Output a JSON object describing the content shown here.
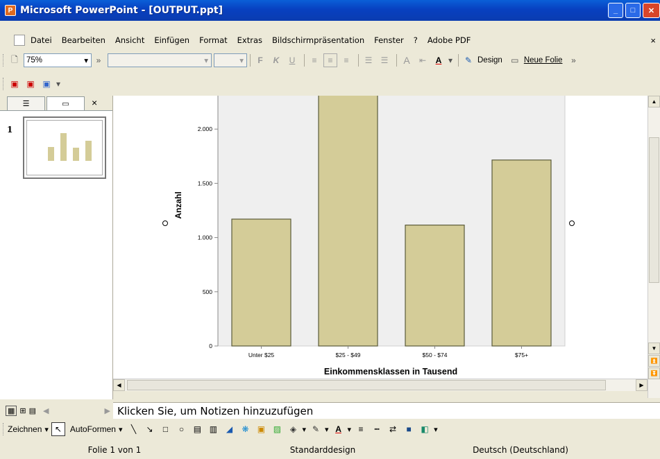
{
  "window": {
    "title": "Microsoft PowerPoint - [OUTPUT.ppt]"
  },
  "menu": [
    "Datei",
    "Bearbeiten",
    "Ansicht",
    "Einfügen",
    "Format",
    "Extras",
    "Bildschirmpräsentation",
    "Fenster",
    "?",
    "Adobe PDF"
  ],
  "menu_close": "×",
  "toolbar": {
    "zoom": "75%",
    "bold": "F",
    "italic": "K",
    "underline": "U",
    "design_label": "Design",
    "new_slide_label": "Neue Folie"
  },
  "panel": {
    "slide_number": "1",
    "close": "×"
  },
  "notes": {
    "placeholder": "Klicken Sie, um Notizen hinzuzufügen"
  },
  "drawing": {
    "draw_label": "Zeichnen",
    "autoshapes_label": "AutoFormen"
  },
  "status": {
    "slide": "Folie 1 von 1",
    "design": "Standarddesign",
    "language": "Deutsch (Deutschland)"
  },
  "colors": {
    "bar": "#d4cc98",
    "bar_stroke": "#5a5a3a",
    "plot_bg": "#efefef"
  },
  "chart_data": {
    "type": "bar",
    "categories": [
      "Unter $25",
      "$25 - $49",
      "$50 - $74",
      "$75+"
    ],
    "values": [
      1170,
      2390,
      1115,
      1715
    ],
    "ylabel": "Anzahl",
    "xlabel": "Einkommensklassen in Tausend",
    "yticks": [
      "0",
      "500",
      "1.000",
      "1.500",
      "2.000"
    ],
    "ylim": [
      0,
      2500
    ]
  }
}
